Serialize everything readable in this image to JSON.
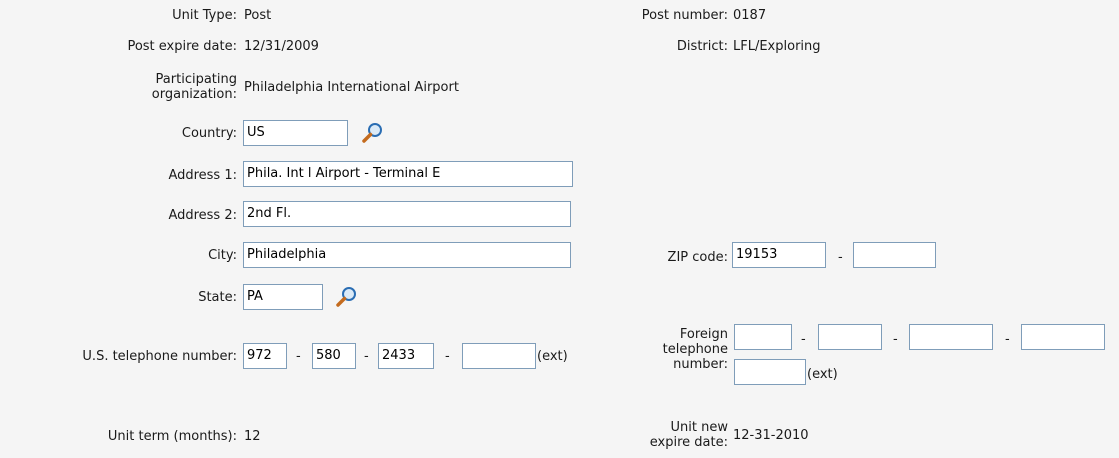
{
  "left": {
    "unit_type": {
      "label": "Unit Type:",
      "value": "Post"
    },
    "post_expire": {
      "label": "Post expire date:",
      "value": "12/31/2009"
    },
    "participating_org": {
      "label_line1": "Participating",
      "label_line2": "organization:",
      "value": "Philadelphia International Airport"
    },
    "country": {
      "label": "Country:",
      "value": "US"
    },
    "address1": {
      "label": "Address 1:",
      "value": "Phila. Int l Airport - Terminal E"
    },
    "address2": {
      "label": "Address 2:",
      "value": "2nd Fl."
    },
    "city": {
      "label": "City:",
      "value": "Philadelphia"
    },
    "state": {
      "label": "State:",
      "value": "PA"
    },
    "us_phone": {
      "label": "U.S. telephone number:",
      "area": "972",
      "prefix": "580",
      "line": "2433",
      "ext": "",
      "ext_label": "(ext)",
      "sep": "-"
    },
    "unit_term": {
      "label": "Unit term (months):",
      "value": "12"
    }
  },
  "right": {
    "post_number": {
      "label": "Post number:",
      "value": "0187"
    },
    "district": {
      "label": "District:",
      "value": "LFL/Exploring"
    },
    "zip": {
      "label": "ZIP code:",
      "value": "19153",
      "ext_value": "",
      "sep": "-"
    },
    "foreign_phone": {
      "label_line1": "Foreign",
      "label_line2": "telephone",
      "label_line3": "number:",
      "f1": "",
      "f2": "",
      "f3": "",
      "f4": "",
      "ext": "",
      "ext_label": "(ext)",
      "sep": "-"
    },
    "new_expire": {
      "label_line1": "Unit new",
      "label_line2": "expire date:",
      "value": "12-31-2010"
    }
  },
  "icons": {
    "lookup": "magnifier-icon"
  }
}
